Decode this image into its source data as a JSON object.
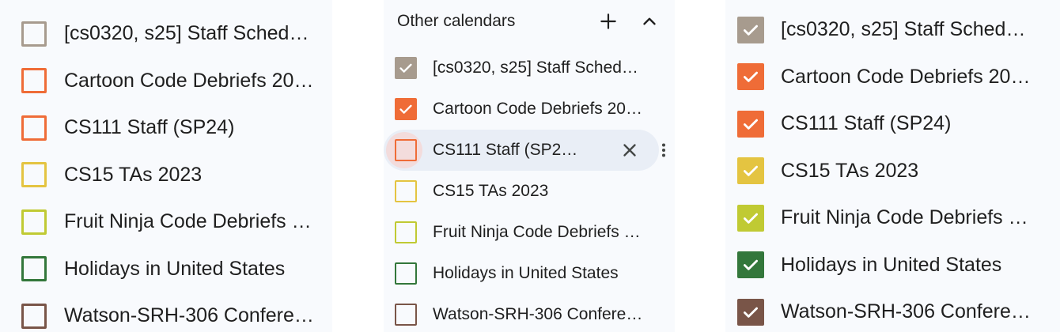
{
  "left_panel": {
    "items": [
      {
        "label": "[cs0320, s25] Staff Sched…",
        "color": "#a79b8e",
        "checked": false
      },
      {
        "label": "Cartoon Code Debriefs 20…",
        "color": "#ef6c37",
        "checked": false
      },
      {
        "label": "CS111 Staff (SP24)",
        "color": "#ef6c37",
        "checked": false
      },
      {
        "label": "CS15 TAs 2023",
        "color": "#e4c441",
        "checked": false
      },
      {
        "label": "Fruit Ninja Code Debriefs …",
        "color": "#c0ca33",
        "checked": false
      },
      {
        "label": "Holidays in United States",
        "color": "#33773b",
        "checked": false
      },
      {
        "label": "Watson-SRH-306 Confere…",
        "color": "#795548",
        "checked": false
      }
    ]
  },
  "middle_panel": {
    "title": "Other calendars",
    "add_icon": "plus-icon",
    "collapse_icon": "chevron-up-icon",
    "remove_icon": "close-icon",
    "more_icon": "more-vert-icon",
    "items": [
      {
        "label": "[cs0320, s25] Staff Sched…",
        "color": "#a79b8e",
        "checked": true
      },
      {
        "label": "Cartoon Code Debriefs 20…",
        "color": "#ef6c37",
        "checked": true
      },
      {
        "label": "CS111 Staff (SP2…",
        "color": "#ef6c37",
        "checked": false,
        "hovered": true
      },
      {
        "label": "CS15 TAs 2023",
        "color": "#e4c441",
        "checked": false
      },
      {
        "label": "Fruit Ninja Code Debriefs …",
        "color": "#c0ca33",
        "checked": false
      },
      {
        "label": "Holidays in United States",
        "color": "#33773b",
        "checked": false
      },
      {
        "label": "Watson-SRH-306 Confere…",
        "color": "#795548",
        "checked": false
      }
    ]
  },
  "right_panel": {
    "items": [
      {
        "label": "[cs0320, s25] Staff Sched…",
        "color": "#a79b8e",
        "checked": true
      },
      {
        "label": "Cartoon Code Debriefs 20…",
        "color": "#ef6c37",
        "checked": true
      },
      {
        "label": "CS111 Staff (SP24)",
        "color": "#ef6c37",
        "checked": true
      },
      {
        "label": "CS15 TAs 2023",
        "color": "#e4c441",
        "checked": true
      },
      {
        "label": "Fruit Ninja Code Debriefs …",
        "color": "#c0ca33",
        "checked": true
      },
      {
        "label": "Holidays in United States",
        "color": "#33773b",
        "checked": true
      },
      {
        "label": "Watson-SRH-306 Confere…",
        "color": "#795548",
        "checked": true
      }
    ]
  }
}
